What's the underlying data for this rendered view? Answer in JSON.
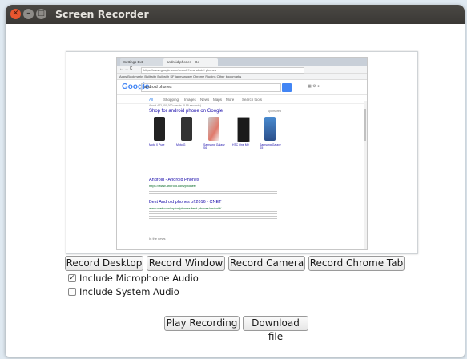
{
  "window": {
    "title": "Screen Recorder",
    "controls": [
      "close",
      "minimize",
      "maximize"
    ]
  },
  "preview": {
    "browser": {
      "tabs": [
        "Settings Ext",
        "android phones - Go"
      ],
      "address": "https://www.google.com/search?q=android+phones",
      "bookmarks": "Apps  Bookmarks  Builtwith  Builtwith  SF tagmanager  Chrome Plugins  Other bookmarks",
      "google_logo": "Google",
      "query": "android phones",
      "nav_tabs": [
        "All",
        "Shopping",
        "Images",
        "News",
        "Maps",
        "More",
        "Search tools"
      ],
      "results_count": "About 472,000,000 results (0.55 seconds)",
      "shop_heading": "Shop for android phone on Google",
      "sponsored": "Sponsored",
      "products": [
        "Moto X Pure",
        "Moto G",
        "Samsung Galaxy S6",
        "HTC One M9",
        "Samsung Galaxy S5"
      ],
      "result1_title": "Android - Android Phones",
      "result1_url": "https://www.android.com/phones/",
      "result2_title": "Best Android phones of 2016 - CNET",
      "result2_url": "www.cnet.com/topics/phones/best-phones/android/",
      "see_more": "In the news"
    }
  },
  "buttons": {
    "record_desktop": "Record Desktop",
    "record_window": "Record Window",
    "record_camera": "Record Camera",
    "record_chrome_tab": "Record Chrome Tab",
    "play_recording": "Play Recording",
    "download_file": "Download file"
  },
  "options": {
    "microphone": {
      "label": "Include Microphone Audio",
      "checked": true
    },
    "system": {
      "label": "Include System Audio",
      "checked": false
    }
  }
}
